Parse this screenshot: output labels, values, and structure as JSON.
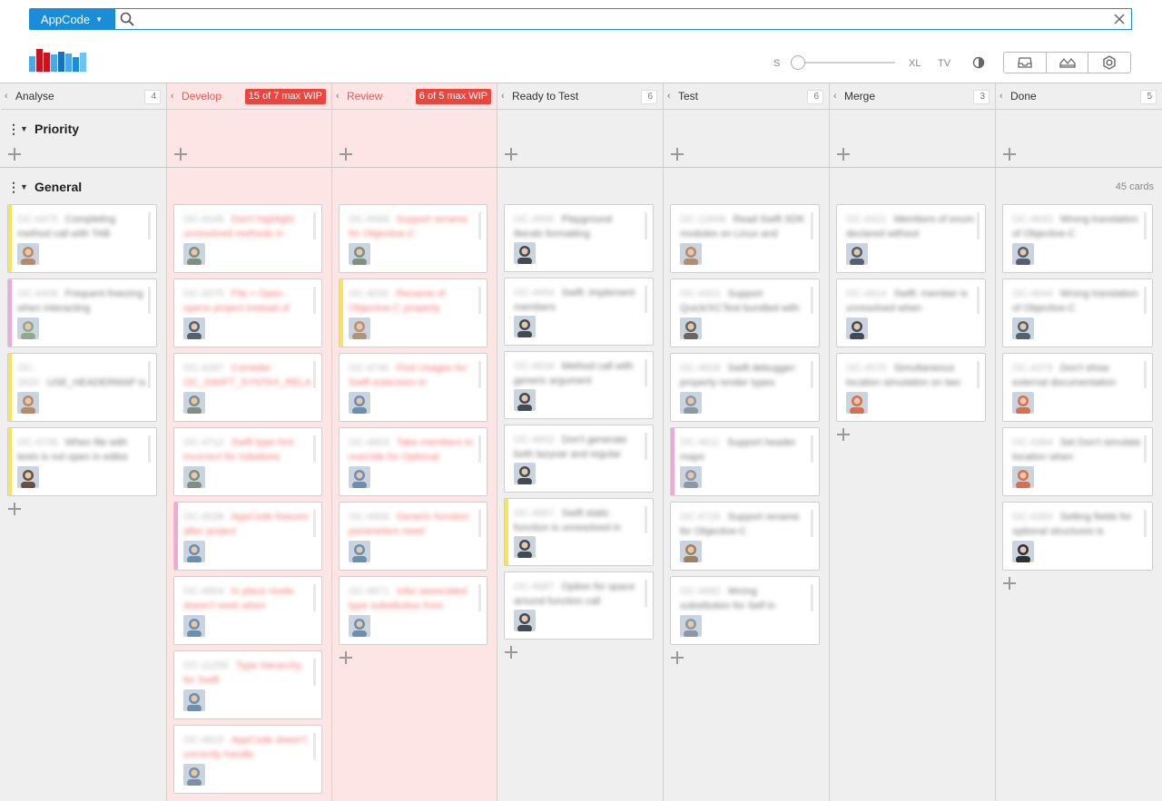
{
  "search": {
    "project_label": "AppCode",
    "query": "",
    "placeholder": ""
  },
  "toolbar": {
    "size_min_label": "S",
    "size_max_label": "XL",
    "tv_label": "TV",
    "size_level": 0.05
  },
  "columns": [
    {
      "name": "Analyse",
      "count": "4",
      "wip": ""
    },
    {
      "name": "Develop",
      "count": "",
      "wip": "15 of 7 max WIP"
    },
    {
      "name": "Review",
      "count": "",
      "wip": "6 of 5 max WIP"
    },
    {
      "name": "Ready to Test",
      "count": "6",
      "wip": ""
    },
    {
      "name": "Test",
      "count": "6",
      "wip": ""
    },
    {
      "name": "Merge",
      "count": "3",
      "wip": ""
    },
    {
      "name": "Done",
      "count": "5",
      "wip": ""
    }
  ],
  "swimlanes": {
    "priority": "Priority",
    "general": "General",
    "cards_count": "45 cards"
  },
  "cards": {
    "analyse": [
      {
        "key": "OC-4475",
        "title": "Completing method call with TAB",
        "stripe": "#f6e45a",
        "avatar": "#b98a6a"
      },
      {
        "key": "OC-4406",
        "title": "Frequent freezing when interacting",
        "stripe": "#f3a7d8",
        "avatar": "#8fa98d"
      },
      {
        "key": "OC-3920",
        "title": "USE_HEADERMAP is not",
        "stripe": "#f6e45a",
        "avatar": "#b98a6a"
      },
      {
        "key": "OC-4736",
        "title": "When file with tests is not open in editor",
        "stripe": "#f6e45a",
        "avatar": "#6a5040"
      }
    ],
    "develop": [
      {
        "key": "OC-4248",
        "title": "Don't highlight unresolved methods in",
        "stripe": "",
        "avatar": "#7f8f80"
      },
      {
        "key": "OC-3375",
        "title": "File > Open opens project instead of",
        "stripe": "",
        "avatar": "#556070"
      },
      {
        "key": "OC-4287",
        "title": "Consider OC_SWIFT_SYNTAX_RELA",
        "stripe": "",
        "avatar": "#7f8f80"
      },
      {
        "key": "OC-4712",
        "title": "Swift type hint incorrect for Initializes",
        "stripe": "",
        "avatar": "#7f8f80"
      },
      {
        "key": "OC-4538",
        "title": "AppCode freezes after project",
        "stripe": "#f3a7d8",
        "avatar": "#6c8fb0"
      },
      {
        "key": "OC-4804",
        "title": "In place mode doesn't work when",
        "stripe": "",
        "avatar": "#6c8fb0"
      },
      {
        "key": "OC-11255",
        "title": "Type hierarchy for Swift",
        "stripe": "",
        "avatar": "#6c8fb0"
      },
      {
        "key": "OC-4815",
        "title": "AppCode doesn't correctly handle",
        "stripe": "",
        "avatar": "#7a90a8"
      }
    ],
    "review": [
      {
        "key": "OC-4669",
        "title": "Support rename for Objective-C",
        "stripe": "",
        "avatar": "#7f8f80"
      },
      {
        "key": "OC-4032",
        "title": "Rename of Objective-C property",
        "stripe": "#f6e45a",
        "avatar": "#b59270"
      },
      {
        "key": "OC-4740",
        "title": "Find Usages for Swift extension in",
        "stripe": "",
        "avatar": "#6c8fb0"
      },
      {
        "key": "OC-4603",
        "title": "Take members to override for Optional",
        "stripe": "",
        "avatar": "#6c8fb0"
      },
      {
        "key": "OC-4609",
        "title": "Generic function parameters need",
        "stripe": "",
        "avatar": "#6c8fb0"
      },
      {
        "key": "OC-4671",
        "title": "Infer associated type substitution from",
        "stripe": "",
        "avatar": "#6c8fb0"
      }
    ],
    "ready": [
      {
        "key": "OC-4500",
        "title": "Playground literals formatting",
        "stripe": "",
        "avatar": "#444a55"
      },
      {
        "key": "OC-4454",
        "title": "Swift: implement members",
        "stripe": "",
        "avatar": "#444a55"
      },
      {
        "key": "OC-4634",
        "title": "Method call with generic argument",
        "stripe": "",
        "avatar": "#444a55"
      },
      {
        "key": "OC-4652",
        "title": "Don't generate both lazyvar and regular",
        "stripe": "",
        "avatar": "#444a55"
      },
      {
        "key": "OC-4667",
        "title": "Swift static function is unresolved in",
        "stripe": "#f6e45a",
        "avatar": "#444a55"
      },
      {
        "key": "OC-4687",
        "title": "Option for space around function call",
        "stripe": "",
        "avatar": "#444a55"
      }
    ],
    "test": [
      {
        "key": "OC-12696",
        "title": "Read Swift SDK modules on Linux and",
        "stripe": "",
        "avatar": "#b98a6a"
      },
      {
        "key": "OC-4321",
        "title": "Support Quick/XCTest bundled with",
        "stripe": "",
        "avatar": "#6a6560"
      },
      {
        "key": "OC-4608",
        "title": "Swift debugger: property render types",
        "stripe": "",
        "avatar": "#8a98a8"
      },
      {
        "key": "OC-4611",
        "title": "Support header maps",
        "stripe": "#f3a7d8",
        "avatar": "#8a98a8"
      },
      {
        "key": "OC-4726",
        "title": "Support rename for Objective-C",
        "stripe": "",
        "avatar": "#a08060"
      },
      {
        "key": "OC-4682",
        "title": "Wrong substitution for Self in",
        "stripe": "",
        "avatar": "#8a98a8"
      }
    ],
    "merge": [
      {
        "key": "OC-4421",
        "title": "Members of enum declared without",
        "stripe": "",
        "avatar": "#556070"
      },
      {
        "key": "OC-4614",
        "title": "Swift: member is unresolved when",
        "stripe": "",
        "avatar": "#444a55"
      },
      {
        "key": "OC-4570",
        "title": "Simultaneous location simulation on two",
        "stripe": "",
        "avatar": "#d87050"
      }
    ],
    "done": [
      {
        "key": "OC-4643",
        "title": "Wrong translation of Objective-C",
        "stripe": "",
        "avatar": "#556070"
      },
      {
        "key": "OC-4644",
        "title": "Wrong translation of Objective-C",
        "stripe": "",
        "avatar": "#556070"
      },
      {
        "key": "OC-4379",
        "title": "Don't show external documentation",
        "stripe": "",
        "avatar": "#d87050"
      },
      {
        "key": "OC-4384",
        "title": "Set Don't simulate location when",
        "stripe": "",
        "avatar": "#d87050"
      },
      {
        "key": "OC-4393",
        "title": "Setting fields for optional structures is",
        "stripe": "",
        "avatar": "#303030"
      }
    ]
  },
  "colors": {
    "accent": "#1a8cd8",
    "wip_bg": "#fde5e5",
    "wip_badge": "#e8463e",
    "board_bg": "#efefef"
  }
}
